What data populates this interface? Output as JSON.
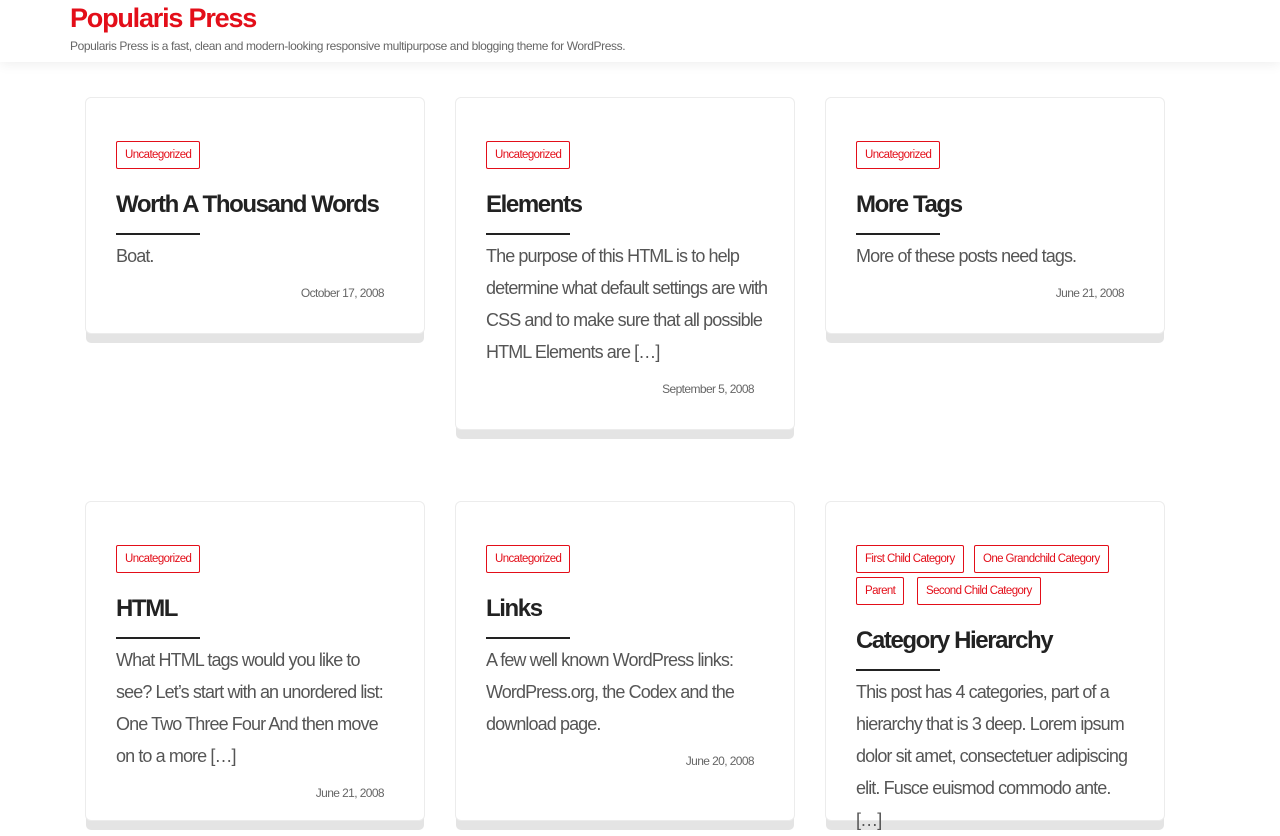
{
  "site": {
    "title": "Popularis Press",
    "tagline": "Popularis Press is a fast, clean and modern-looking responsive multipurpose and blogging theme for WordPress."
  },
  "colors": {
    "accent": "#e30e19",
    "title_text": "#222222",
    "body_text": "#555555"
  },
  "posts": [
    {
      "categories": [
        "Uncategorized"
      ],
      "title": "Worth A Thousand Words",
      "excerpt": "Boat.",
      "date": "October 17, 2008"
    },
    {
      "categories": [
        "Uncategorized"
      ],
      "title": "Elements",
      "excerpt": "The purpose of this HTML is to help determine what default settings are with CSS and to make sure that all possible HTML Elements are […]",
      "date": "September 5, 2008"
    },
    {
      "categories": [
        "Uncategorized"
      ],
      "title": "More Tags",
      "excerpt": "More of these posts need tags.",
      "date": "June 21, 2008"
    },
    {
      "categories": [
        "Uncategorized"
      ],
      "title": "HTML",
      "excerpt": "What HTML tags would you like to see? Let’s start with an unordered list: One Two Three Four And then move on to a more […]",
      "date": "June 21, 2008"
    },
    {
      "categories": [
        "Uncategorized"
      ],
      "title": "Links",
      "excerpt": "A few well known WordPress links: WordPress.org, the Codex and the download page.",
      "date": "June 20, 2008"
    },
    {
      "categories": [
        "First Child Category",
        "One Grandchild Category",
        "Parent",
        "Second Child Category"
      ],
      "title": "Category Hierarchy",
      "excerpt": "This post has 4 categories, part of a hierarchy that is 3 deep. Lorem ipsum dolor sit amet, consectetuer adipiscing elit. Fusce euismod commodo ante. […]",
      "date": ""
    }
  ]
}
